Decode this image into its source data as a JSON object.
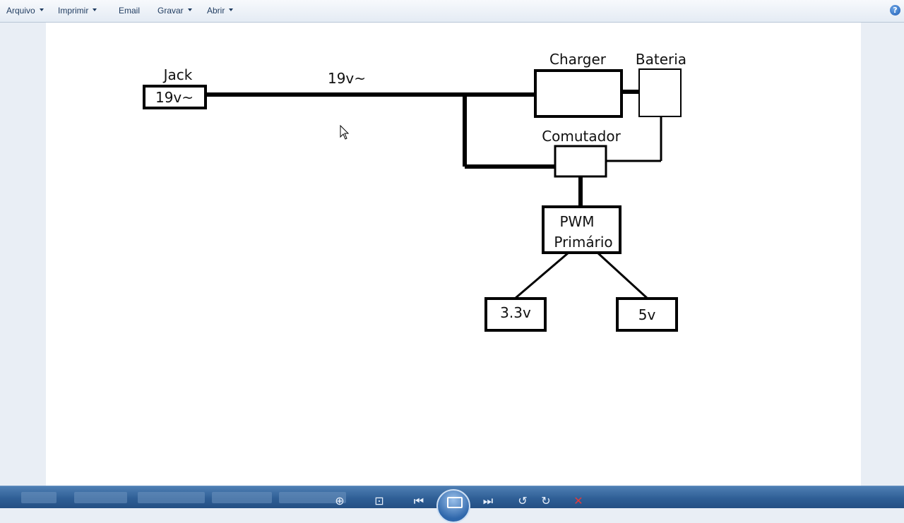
{
  "menu": {
    "items": [
      {
        "label": "Arquivo",
        "has_dropdown": true
      },
      {
        "label": "Imprimir",
        "has_dropdown": true
      },
      {
        "label": "Email",
        "has_dropdown": false
      },
      {
        "label": "Gravar",
        "has_dropdown": true
      },
      {
        "label": "Abrir",
        "has_dropdown": true
      }
    ],
    "help_icon": "help-icon"
  },
  "diagram": {
    "jack_title": "Jack",
    "jack_value": "19v~",
    "line_label": "19v~",
    "charger": "Charger",
    "bateria": "Bateria",
    "comutador": "Comutador",
    "pwm_line1": "PWM",
    "pwm_line2": "Primário",
    "out_33": "3.3v",
    "out_5": "5v"
  },
  "toolbar": {
    "icons": [
      "zoom-icon",
      "fit-window-icon",
      "previous-icon",
      "slideshow-icon",
      "next-icon",
      "rotate-left-icon",
      "rotate-right-icon",
      "delete-icon"
    ]
  },
  "colors": {
    "menubar": "#eef2f8",
    "toolbar": "#2f5f96",
    "delete": "#e23b3b"
  }
}
